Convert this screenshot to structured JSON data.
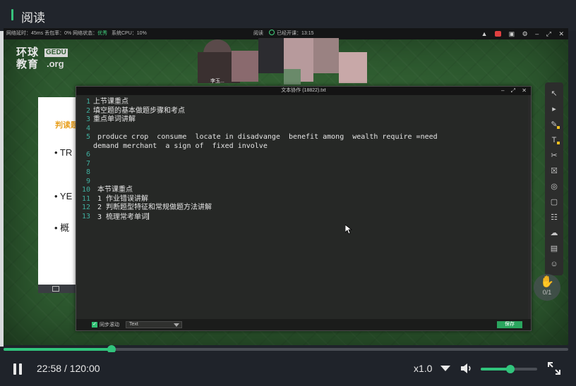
{
  "header": {
    "title": "阅读",
    "accent_color": "#37c27c"
  },
  "status_bar": {
    "delay_label": "网络延时：45ms",
    "loss_label": "丢包率：0%",
    "net_label": "网络状态：",
    "net_value": "优秀",
    "cpu_label": "系统CPU：10%",
    "mode": "阅读",
    "started": "已经开课：13:15",
    "icons": [
      "bell-icon",
      "record-icon",
      "window-icon",
      "settings-icon",
      "minimize-icon",
      "maximize-icon",
      "close-icon"
    ]
  },
  "logo": {
    "cn": "环球\n教育",
    "tag": "GEDU",
    "org": ".org"
  },
  "participant_name": "李玉...",
  "slide": {
    "heading": "判读题",
    "bullets": [
      "• TR",
      "• YE",
      "• 概"
    ]
  },
  "notepad": {
    "title": "文本协作 (18822).txt",
    "line_numbers": [
      "1",
      "2",
      "3",
      "4",
      "5",
      "",
      "6",
      "7",
      "8",
      "9",
      "10",
      "11",
      "12",
      "13"
    ],
    "lines": [
      "上节课重点",
      "填空题的基本做题步骤和考点",
      "重点单词讲解",
      "",
      " produce crop  consume  locate in disadvange  benefit among  wealth require =need",
      "demand merchant  a sign of  fixed involve",
      "",
      "",
      "",
      "",
      " 本节课重点",
      " 1 作业错误讲解",
      " 2 判断题型特征和常规做题方法讲解",
      " 3 梳理常考单词"
    ],
    "sync_label": "同步滚动",
    "format_value": "Text",
    "save_label": "保存"
  },
  "tools": [
    "pointer-icon",
    "select-icon",
    "pen-icon",
    "text-icon",
    "scissors-icon",
    "trash-icon",
    "laser-icon",
    "whiteboard-icon",
    "chat-icon",
    "cloud-icon",
    "toolbox-icon",
    "users-icon"
  ],
  "hand": {
    "count": "0/1"
  },
  "player": {
    "current_time": "22:58",
    "separator": "/",
    "total_time": "120:00",
    "progress_fraction": 0.1915,
    "speed": "x1.0",
    "volume_fraction": 0.52,
    "accent_color": "#31c47c"
  }
}
